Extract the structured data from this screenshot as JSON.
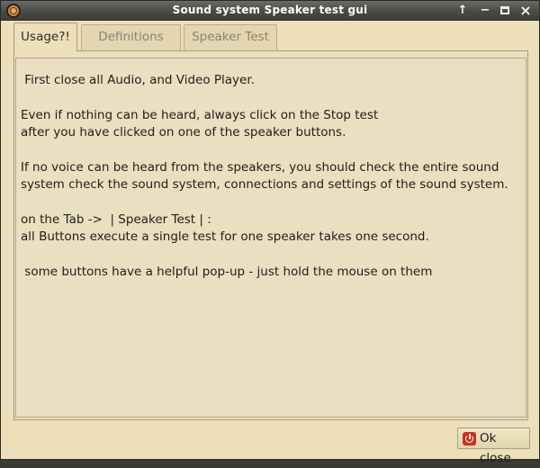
{
  "window": {
    "title": "Sound system Speaker test gui"
  },
  "tabs": [
    {
      "label": "Usage?!",
      "active": true
    },
    {
      "label": "Definitions",
      "active": false
    },
    {
      "label": "Speaker Test",
      "active": false
    }
  ],
  "usage_text": {
    "lines": [
      " First close all Audio, and Video Player.",
      "Even if nothing can be heard, always click on the Stop test",
      "after you have clicked on one of the speaker buttons.",
      "If no voice can be heard from the speakers, you should check the entire sound",
      "system check the sound system, connections and settings of the sound system.",
      "on the Tab ->  | Speaker Test | :",
      "all Buttons execute a single test for one speaker takes one second.",
      " some buttons have a helpful pop-up - just hold the mouse on them"
    ]
  },
  "footer": {
    "ok_label": "Ok close"
  },
  "icons": {
    "app": "speaker-icon",
    "titlebar_up": "arrow-up-icon",
    "titlebar_min": "minimize-icon",
    "titlebar_max": "maximize-icon",
    "titlebar_close": "close-icon",
    "ok": "power-icon"
  },
  "colors": {
    "window_bg": "#ecdfb9",
    "titlebar": "#4a4a47",
    "ok_icon": "#c8321e"
  }
}
